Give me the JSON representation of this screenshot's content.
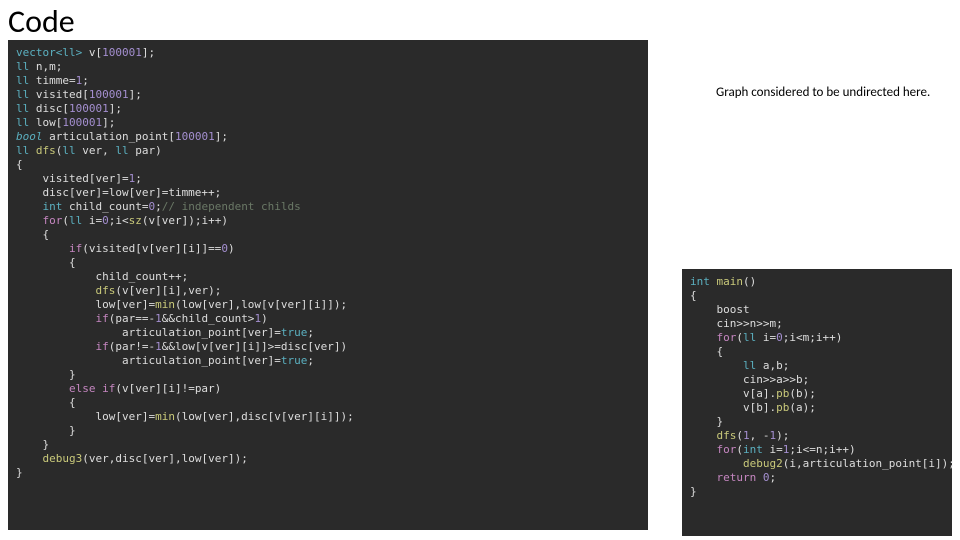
{
  "title": "Code",
  "note": "Graph considered to be undirected here.",
  "left": {
    "l01a": "vector<ll>",
    "l01b": " v[",
    "l01c": "100001",
    "l01d": "];",
    "l02": "ll",
    "l02b": " n,m;",
    "l03": "ll",
    "l03b": " timme=",
    "l03c": "1",
    "l03d": ";",
    "l04": "ll",
    "l04b": " visited[",
    "l04c": "100001",
    "l04d": "];",
    "l05": "ll",
    "l05b": " disc[",
    "l05c": "100001",
    "l05d": "];",
    "l06": "ll",
    "l06b": " low[",
    "l06c": "100001",
    "l06d": "];",
    "l07": "bool",
    "l07b": " articulation_point[",
    "l07c": "100001",
    "l07d": "];",
    "l08": "ll",
    "l08b": " ",
    "l08c": "dfs",
    "l08d": "(",
    "l08e": "ll",
    "l08f": " ver, ",
    "l08g": "ll",
    "l08h": " par)",
    "l09": "{",
    "l10": "    visited[ver]=",
    "l10b": "1",
    "l10c": ";",
    "l11": "    disc[ver]=low[ver]=timme++;",
    "l12a": "    ",
    "l12b": "int",
    "l12c": " child_count=",
    "l12d": "0",
    "l12e": ";",
    "l12f": "// independent childs",
    "l13a": "    ",
    "l13b": "for",
    "l13c": "(",
    "l13d": "ll",
    "l13e": " i=",
    "l13f": "0",
    "l13g": ";i<",
    "l13h": "sz",
    "l13i": "(v[ver]);i++)",
    "l14": "    {",
    "l15a": "        ",
    "l15b": "if",
    "l15c": "(visited[v[ver][i]]==",
    "l15d": "0",
    "l15e": ")",
    "l16": "        {",
    "l17": "            child_count++;",
    "l18a": "            ",
    "l18b": "dfs",
    "l18c": "(v[ver][i],ver);",
    "l19a": "            low[ver]=",
    "l19b": "min",
    "l19c": "(low[ver],low[v[ver][i]]);",
    "l20a": "            ",
    "l20b": "if",
    "l20c": "(par==-",
    "l20d": "1",
    "l20e": "&&child_count>",
    "l20f": "1",
    "l20g": ")",
    "l21a": "                articulation_point[ver]=",
    "l21b": "true",
    "l21c": ";",
    "l22a": "            ",
    "l22b": "if",
    "l22c": "(par!=-",
    "l22d": "1",
    "l22e": "&&low[v[ver][i]]>=disc[ver])",
    "l23a": "                articulation_point[ver]=",
    "l23b": "true",
    "l23c": ";",
    "l24": "        }",
    "l25a": "        ",
    "l25b": "else if",
    "l25c": "(v[ver][i]!=par)",
    "l26": "        {",
    "l27a": "            low[ver]=",
    "l27b": "min",
    "l27c": "(low[ver],disc[v[ver][i]]);",
    "l28": "        }",
    "l29": "    }",
    "l30a": "    ",
    "l30b": "debug3",
    "l30c": "(ver,disc[ver],low[ver]);",
    "l31": "}"
  },
  "right": {
    "r01a": "int",
    "r01b": " ",
    "r01c": "main",
    "r01d": "()",
    "r02": "{",
    "r03": "    boost",
    "r04": "    cin>>n>>m;",
    "r05a": "    ",
    "r05b": "for",
    "r05c": "(",
    "r05d": "ll",
    "r05e": " i=",
    "r05f": "0",
    "r05g": ";i<m;i++)",
    "r06": "    {",
    "r07a": "        ",
    "r07b": "ll",
    "r07c": " a,b;",
    "r08": "        cin>>a>>b;",
    "r09a": "        v[a].",
    "r09b": "pb",
    "r09c": "(b);",
    "r10a": "        v[b].",
    "r10b": "pb",
    "r10c": "(a);",
    "r11": "    }",
    "r12a": "    ",
    "r12b": "dfs",
    "r12c": "(",
    "r12d": "1",
    "r12e": ", -",
    "r12f": "1",
    "r12g": ");",
    "r13a": "    ",
    "r13b": "for",
    "r13c": "(",
    "r13d": "int",
    "r13e": " i=",
    "r13f": "1",
    "r13g": ";i<=n;i++)",
    "r14a": "        ",
    "r14b": "debug2",
    "r14c": "(i,articulation_point[i]);",
    "r15a": "    ",
    "r15b": "return",
    "r15c": " ",
    "r15d": "0",
    "r15e": ";",
    "r16": "}"
  }
}
